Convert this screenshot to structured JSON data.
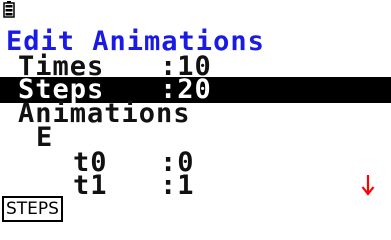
{
  "status": {
    "battery_icon": "battery-icon"
  },
  "title": "Edit Animations",
  "settings": [
    {
      "label": "Times",
      "value": ":10",
      "selected": false
    },
    {
      "label": "Steps",
      "value": ":20",
      "selected": true
    }
  ],
  "section_label": "Animations",
  "group_label": "E",
  "params": [
    {
      "label": "t0",
      "value": ":0"
    },
    {
      "label": "t1",
      "value": ":1"
    }
  ],
  "scroll_indicator": "down-arrow-icon",
  "function_keys": {
    "f1": "STEPS"
  },
  "colors": {
    "title": "#1a1ae6",
    "selection": "#000000",
    "scroll_arrow": "#ff0000"
  }
}
